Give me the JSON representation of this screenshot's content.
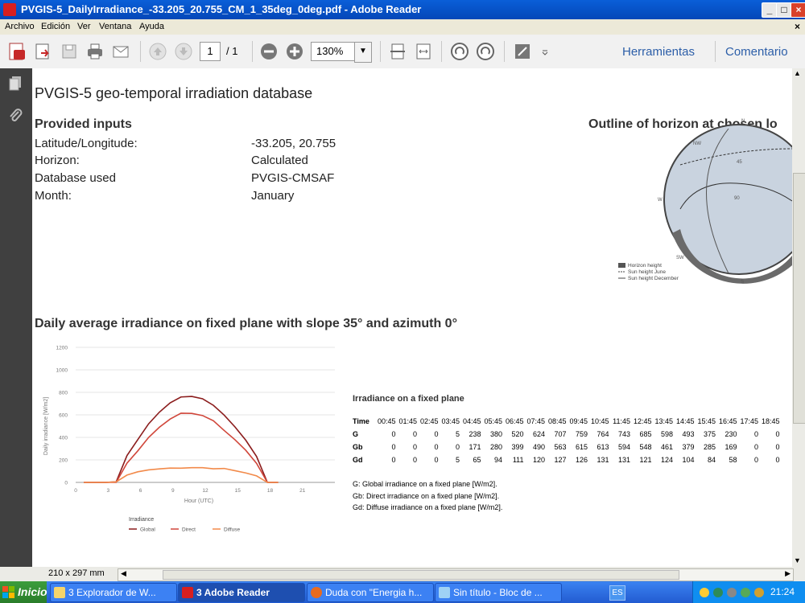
{
  "window": {
    "title": "PVGIS-5_DailyIrradiance_-33.205_20.755_CM_1_35deg_0deg.pdf - Adobe Reader",
    "controls": [
      "_",
      "□",
      "×"
    ]
  },
  "menu": {
    "items": [
      "Archivo",
      "Edición",
      "Ver",
      "Ventana",
      "Ayuda"
    ],
    "close": "×"
  },
  "toolbar": {
    "page_current": "1",
    "page_total": "/ 1",
    "zoom": "130%",
    "tools_label": "Herramientas",
    "comment_label": "Comentario",
    "icons": [
      "create-pdf-icon",
      "open-icon",
      "save-icon",
      "print-icon",
      "email-icon",
      "previous-page-icon",
      "next-page-icon",
      "zoom-out-icon",
      "zoom-in-icon",
      "fit-page-icon",
      "fit-width-icon",
      "rotate-left-icon",
      "rotate-right-icon",
      "fullscreen-icon"
    ]
  },
  "page": {
    "heading": "PVGIS-5 geo-temporal irradiation database",
    "inputs_title": "Provided inputs",
    "inputs": [
      {
        "label": "Latitude/Longitude:",
        "value": "-33.205, 20.755"
      },
      {
        "label": "Horizon:",
        "value": "Calculated"
      },
      {
        "label": "Database used",
        "value": "PVGIS-CMSAF"
      },
      {
        "label": "Month:",
        "value": "January"
      }
    ],
    "horizon_title": "Outline of horizon at chosen lo",
    "horizon_legend": [
      "Horizon height",
      "Sun height June",
      "Sun height December"
    ],
    "horizon_labels": {
      "n": "N",
      "nw": "NW",
      "w": "W",
      "sw": "SW",
      "s": "S",
      "deg45": "45",
      "deg90": "90"
    },
    "daily_title": "Daily average irradiance on fixed plane with slope 35° and azimuth 0°",
    "table_title": "Irradiance on a fixed plane",
    "table_header": [
      "Time",
      "00:45",
      "01:45",
      "02:45",
      "03:45",
      "04:45",
      "05:45",
      "06:45",
      "07:45",
      "08:45",
      "09:45",
      "10:45",
      "11:45",
      "12:45",
      "13:45",
      "14:45",
      "15:45",
      "16:45",
      "17:45",
      "18:45"
    ],
    "table_rows": [
      {
        "label": "G",
        "values": [
          "0",
          "0",
          "0",
          "5",
          "238",
          "380",
          "520",
          "624",
          "707",
          "759",
          "764",
          "743",
          "685",
          "598",
          "493",
          "375",
          "230",
          "0",
          "0"
        ]
      },
      {
        "label": "Gb",
        "values": [
          "0",
          "0",
          "0",
          "0",
          "171",
          "280",
          "399",
          "490",
          "563",
          "615",
          "613",
          "594",
          "548",
          "461",
          "379",
          "285",
          "169",
          "0",
          "0"
        ]
      },
      {
        "label": "Gd",
        "values": [
          "0",
          "0",
          "0",
          "5",
          "65",
          "94",
          "111",
          "120",
          "127",
          "126",
          "131",
          "131",
          "121",
          "124",
          "104",
          "84",
          "58",
          "0",
          "0"
        ]
      }
    ],
    "notes": [
      "G: Global irradiance on a fixed plane [W/m2].",
      "Gb: Direct irradiance on a fixed plane [W/m2].",
      "Gd:  Diffuse irradiance on a fixed plane [W/m2]."
    ]
  },
  "chart_data": {
    "type": "line",
    "xlabel": "Hour (UTC)",
    "ylabel": "Daily irradiance [W/m2]",
    "xlim": [
      0,
      24
    ],
    "ylim": [
      0,
      1200
    ],
    "yticks": [
      "0",
      "200",
      "400",
      "600",
      "800",
      "1000",
      "1200"
    ],
    "xticks": [
      "0",
      "3",
      "6",
      "9",
      "12",
      "15",
      "18",
      "21"
    ],
    "legend_title": "Irradiance",
    "series": [
      {
        "name": "Global",
        "color": "#8b1c1c",
        "x": [
          0.75,
          1.75,
          2.75,
          3.75,
          4.75,
          5.75,
          6.75,
          7.75,
          8.75,
          9.75,
          10.75,
          11.75,
          12.75,
          13.75,
          14.75,
          15.75,
          16.75,
          17.75,
          18.75
        ],
        "values": [
          0,
          0,
          0,
          5,
          238,
          380,
          520,
          624,
          707,
          759,
          764,
          743,
          685,
          598,
          493,
          375,
          230,
          0,
          0
        ]
      },
      {
        "name": "Direct",
        "color": "#d0463a",
        "x": [
          0.75,
          1.75,
          2.75,
          3.75,
          4.75,
          5.75,
          6.75,
          7.75,
          8.75,
          9.75,
          10.75,
          11.75,
          12.75,
          13.75,
          14.75,
          15.75,
          16.75,
          17.75,
          18.75
        ],
        "values": [
          0,
          0,
          0,
          0,
          171,
          280,
          399,
          490,
          563,
          615,
          613,
          594,
          548,
          461,
          379,
          285,
          169,
          0,
          0
        ]
      },
      {
        "name": "Diffuse",
        "color": "#f28a4a",
        "x": [
          0.75,
          1.75,
          2.75,
          3.75,
          4.75,
          5.75,
          6.75,
          7.75,
          8.75,
          9.75,
          10.75,
          11.75,
          12.75,
          13.75,
          14.75,
          15.75,
          16.75,
          17.75,
          18.75
        ],
        "values": [
          0,
          0,
          0,
          5,
          65,
          94,
          111,
          120,
          127,
          126,
          131,
          131,
          121,
          124,
          104,
          84,
          58,
          0,
          0
        ]
      }
    ]
  },
  "status": {
    "page_size": "210 x 297 mm"
  },
  "taskbar": {
    "start": "Inicio",
    "buttons": [
      "3 Explorador de W...",
      "3 Adobe Reader",
      "Duda con \"Energia h...",
      "Sin título - Bloc de ..."
    ],
    "lang": "ES",
    "time": "21:24"
  }
}
